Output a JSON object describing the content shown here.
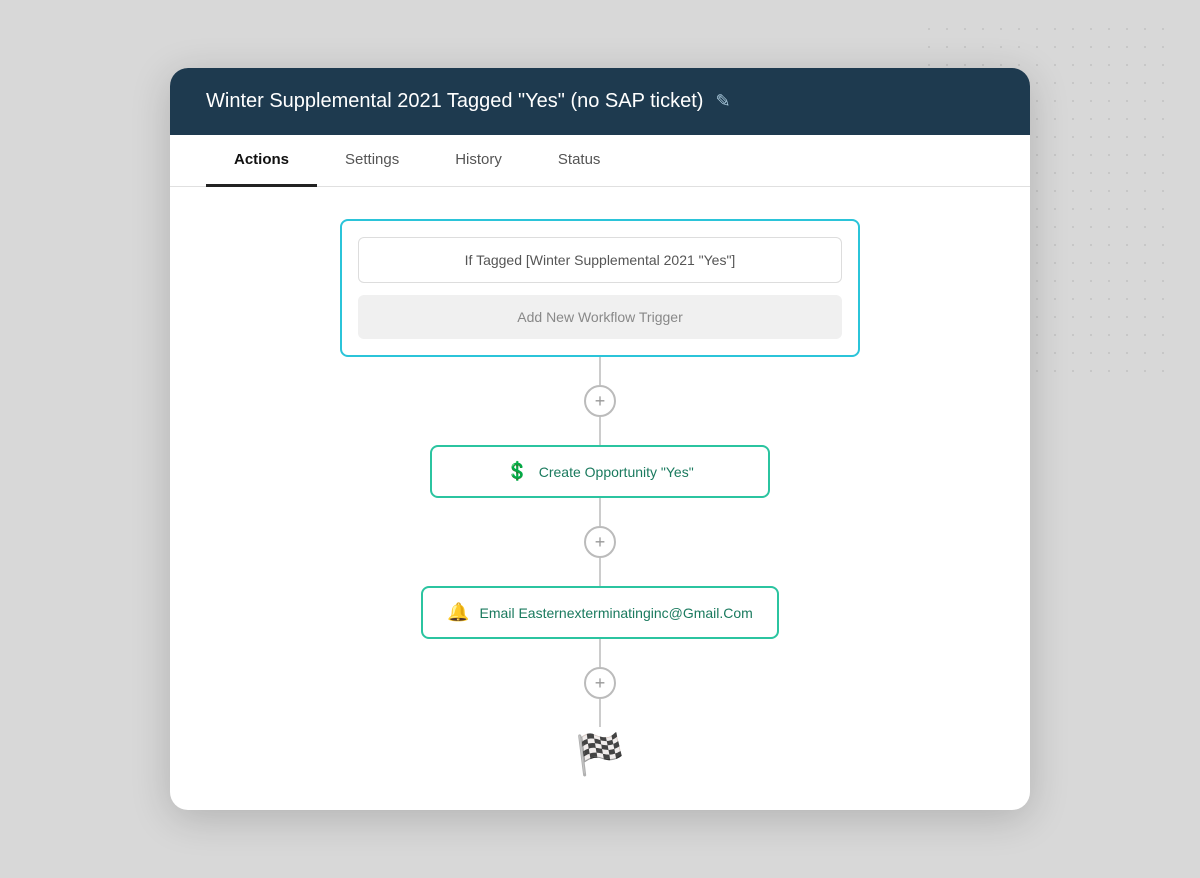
{
  "card": {
    "title": "Winter Supplemental 2021 Tagged \"Yes\" (no SAP ticket)",
    "edit_icon": "✎"
  },
  "tabs": [
    {
      "label": "Actions",
      "active": true
    },
    {
      "label": "Settings",
      "active": false
    },
    {
      "label": "History",
      "active": false
    },
    {
      "label": "Status",
      "active": false
    }
  ],
  "trigger": {
    "condition_label": "If Tagged [Winter Supplemental 2021 \"Yes\"]",
    "add_trigger_label": "Add New Workflow Trigger"
  },
  "actions": [
    {
      "icon": "💲",
      "label": "Create Opportunity \"Yes\""
    },
    {
      "icon": "🔔",
      "label": "Email Easternexterminatinginc@Gmail.Com"
    }
  ],
  "finish_icon": "🏁"
}
